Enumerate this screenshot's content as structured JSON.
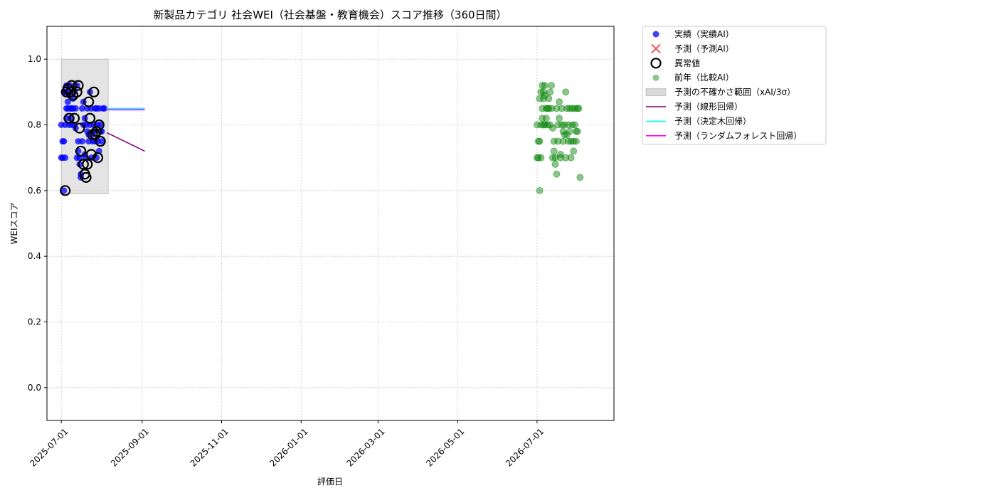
{
  "chart_data": {
    "type": "scatter",
    "title": "新製品カテゴリ 社会WEI（社会基盤・教育機会）スコア推移（360日間）",
    "xlabel": "評価日",
    "ylabel": "WEIスコア",
    "xlim": [
      "2025-06-20",
      "2026-08-29"
    ],
    "ylim": [
      -0.1,
      1.1
    ],
    "x_ticks": [
      "2025-07-01",
      "2025-09-01",
      "2025-11-01",
      "2026-01-01",
      "2026-03-01",
      "2026-05-01",
      "2026-07-01"
    ],
    "y_ticks": [
      0.0,
      0.2,
      0.4,
      0.6,
      0.8,
      1.0
    ],
    "grid": true,
    "legend_position": "outside-right",
    "legend": [
      {
        "label": "実績（実績AI）",
        "marker": "dot",
        "color": "#0000ff"
      },
      {
        "label": "予測（予測AI）",
        "marker": "x",
        "color": "#ff0000"
      },
      {
        "label": "異常値",
        "marker": "ring",
        "color": "#000000"
      },
      {
        "label": "前年（比較AI）",
        "marker": "dot",
        "color": "#008000"
      },
      {
        "label": "予測の不確かさ範囲（xAI/3σ）",
        "marker": "band",
        "color": "#d9d9d9"
      },
      {
        "label": "予測（線形回帰）",
        "marker": "line",
        "color": "#800080"
      },
      {
        "label": "予測（決定木回帰）",
        "marker": "line",
        "color": "#00ffff"
      },
      {
        "label": "予測（ランダムフォレスト回帰）",
        "marker": "line",
        "color": "#ff00ff"
      }
    ],
    "uncertainty_band": {
      "x_start": "2025-07-01",
      "x_end": "2025-08-06",
      "y_low": 0.59,
      "y_high": 1.0
    },
    "forecast_lines": [
      {
        "name": "予測（線形回帰）",
        "color": "#800080",
        "x": [
          "2025-08-05",
          "2025-09-03"
        ],
        "y": [
          0.776,
          0.72
        ]
      },
      {
        "name": "予測（決定木回帰）",
        "color": "#00ffff",
        "x": [
          "2025-08-05",
          "2025-09-03"
        ],
        "y": [
          0.85,
          0.85
        ]
      },
      {
        "name": "予測（ランダムフォレスト回帰）",
        "color": "#ff00ff",
        "x": [
          "2025-08-05",
          "2025-09-03"
        ],
        "y": [
          0.846,
          0.846
        ]
      }
    ],
    "series": [
      {
        "name": "実績（実績AI）",
        "color": "#0000ff",
        "x": [
          "2025-07-01",
          "2025-07-01",
          "2025-07-02",
          "2025-07-02",
          "2025-07-03",
          "2025-07-03",
          "2025-07-03",
          "2025-07-04",
          "2025-07-04",
          "2025-07-04",
          "2025-07-05",
          "2025-07-05",
          "2025-07-05",
          "2025-07-06",
          "2025-07-06",
          "2025-07-07",
          "2025-07-07",
          "2025-07-07",
          "2025-07-08",
          "2025-07-08",
          "2025-07-08",
          "2025-07-09",
          "2025-07-09",
          "2025-07-10",
          "2025-07-10",
          "2025-07-11",
          "2025-07-11",
          "2025-07-12",
          "2025-07-12",
          "2025-07-13",
          "2025-07-13",
          "2025-07-14",
          "2025-07-14",
          "2025-07-15",
          "2025-07-15",
          "2025-07-16",
          "2025-07-16",
          "2025-07-17",
          "2025-07-17",
          "2025-07-18",
          "2025-07-18",
          "2025-07-19",
          "2025-07-19",
          "2025-07-20",
          "2025-07-20",
          "2025-07-21",
          "2025-07-21",
          "2025-07-22",
          "2025-07-22",
          "2025-07-23",
          "2025-07-23",
          "2025-07-24",
          "2025-07-24",
          "2025-07-25",
          "2025-07-25",
          "2025-07-26",
          "2025-07-26",
          "2025-07-27",
          "2025-07-27",
          "2025-07-28",
          "2025-07-28",
          "2025-07-29",
          "2025-07-29",
          "2025-07-30",
          "2025-07-30",
          "2025-07-31",
          "2025-07-31",
          "2025-08-01",
          "2025-08-01",
          "2025-08-02",
          "2025-08-03"
        ],
        "y": [
          0.8,
          0.7,
          0.7,
          0.75,
          0.6,
          0.9,
          0.75,
          0.7,
          0.9,
          0.8,
          0.85,
          0.92,
          0.82,
          0.87,
          0.85,
          0.9,
          0.8,
          0.89,
          0.92,
          0.82,
          0.85,
          0.85,
          0.8,
          0.88,
          0.85,
          0.8,
          0.9,
          0.85,
          0.79,
          0.92,
          0.7,
          0.72,
          0.75,
          0.7,
          0.68,
          0.65,
          0.64,
          0.85,
          0.75,
          0.8,
          0.87,
          0.82,
          0.71,
          0.7,
          0.8,
          0.85,
          0.78,
          0.75,
          0.77,
          0.8,
          0.9,
          0.7,
          0.85,
          0.77,
          0.75,
          0.8,
          0.78,
          0.85,
          0.75,
          0.7,
          0.85,
          0.8,
          0.75,
          0.72,
          0.85,
          0.8,
          0.78,
          0.75,
          0.78,
          0.85,
          0.85
        ]
      },
      {
        "name": "異常値",
        "color": "#000000",
        "x": [
          "2025-07-04",
          "2025-07-05",
          "2025-07-06",
          "2025-07-07",
          "2025-07-08",
          "2025-07-09",
          "2025-07-10",
          "2025-07-11",
          "2025-07-13",
          "2025-07-14",
          "2025-07-15",
          "2025-07-16",
          "2025-07-18",
          "2025-07-19",
          "2025-07-20",
          "2025-07-21",
          "2025-07-22",
          "2025-07-23",
          "2025-07-24",
          "2025-07-25",
          "2025-07-26",
          "2025-07-27",
          "2025-07-28",
          "2025-07-29",
          "2025-07-30",
          "2025-07-31"
        ],
        "y": [
          0.6,
          0.9,
          0.91,
          0.82,
          0.9,
          0.92,
          0.89,
          0.82,
          0.9,
          0.92,
          0.79,
          0.72,
          0.68,
          0.65,
          0.64,
          0.68,
          0.87,
          0.82,
          0.71,
          0.77,
          0.9,
          0.77,
          0.78,
          0.7,
          0.8,
          0.75
        ]
      },
      {
        "name": "前年（比較AI）",
        "color": "#008000",
        "x": [
          "2026-07-01",
          "2026-07-01",
          "2026-07-02",
          "2026-07-02",
          "2026-07-03",
          "2026-07-03",
          "2026-07-03",
          "2026-07-04",
          "2026-07-04",
          "2026-07-04",
          "2026-07-05",
          "2026-07-05",
          "2026-07-05",
          "2026-07-06",
          "2026-07-06",
          "2026-07-06",
          "2026-07-07",
          "2026-07-07",
          "2026-07-07",
          "2026-07-08",
          "2026-07-08",
          "2026-07-09",
          "2026-07-09",
          "2026-07-10",
          "2026-07-10",
          "2026-07-11",
          "2026-07-11",
          "2026-07-12",
          "2026-07-12",
          "2026-07-13",
          "2026-07-13",
          "2026-07-14",
          "2026-07-14",
          "2026-07-15",
          "2026-07-15",
          "2026-07-16",
          "2026-07-16",
          "2026-07-17",
          "2026-07-17",
          "2026-07-18",
          "2026-07-18",
          "2026-07-19",
          "2026-07-19",
          "2026-07-20",
          "2026-07-20",
          "2026-07-21",
          "2026-07-21",
          "2026-07-22",
          "2026-07-22",
          "2026-07-23",
          "2026-07-23",
          "2026-07-24",
          "2026-07-24",
          "2026-07-25",
          "2026-07-25",
          "2026-07-26",
          "2026-07-26",
          "2026-07-27",
          "2026-07-27",
          "2026-07-28",
          "2026-07-28",
          "2026-07-29",
          "2026-07-29",
          "2026-07-30",
          "2026-07-30",
          "2026-07-31",
          "2026-07-31",
          "2026-08-01",
          "2026-08-01",
          "2026-08-02",
          "2026-08-03"
        ],
        "y": [
          0.8,
          0.7,
          0.7,
          0.75,
          0.6,
          0.88,
          0.75,
          0.7,
          0.9,
          0.8,
          0.85,
          0.92,
          0.82,
          0.88,
          0.8,
          0.9,
          0.8,
          0.89,
          0.92,
          0.82,
          0.85,
          0.85,
          0.8,
          0.88,
          0.85,
          0.8,
          0.9,
          0.85,
          0.92,
          0.79,
          0.7,
          0.72,
          0.75,
          0.7,
          0.68,
          0.65,
          0.85,
          0.75,
          0.8,
          0.87,
          0.82,
          0.71,
          0.7,
          0.8,
          0.85,
          0.78,
          0.75,
          0.77,
          0.8,
          0.9,
          0.7,
          0.85,
          0.77,
          0.75,
          0.8,
          0.78,
          0.85,
          0.75,
          0.7,
          0.85,
          0.8,
          0.75,
          0.72,
          0.85,
          0.8,
          0.78,
          0.75,
          0.78,
          0.85,
          0.85,
          0.64
        ]
      }
    ]
  }
}
